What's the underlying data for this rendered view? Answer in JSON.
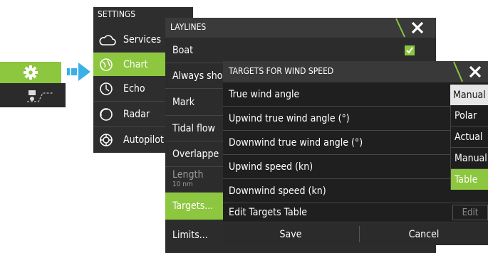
{
  "launcher": {
    "settings_icon": "gear-icon",
    "chart_icon": "chart-icon",
    "arrow_icon": "arrow-right-icon"
  },
  "settings": {
    "title": "SETTINGS",
    "items": [
      {
        "label": "Services",
        "icon": "cloud-icon"
      },
      {
        "label": "Chart",
        "icon": "globe-icon",
        "selected": true
      },
      {
        "label": "Echo",
        "icon": "echo-icon"
      },
      {
        "label": "Radar",
        "icon": "radar-icon"
      },
      {
        "label": "Autopilot",
        "icon": "autopilot-icon"
      }
    ]
  },
  "laylines": {
    "title": "LAYLINES",
    "items": [
      {
        "label": "Boat",
        "checked": true
      },
      {
        "label": "Always sho"
      },
      {
        "label": "Mark"
      },
      {
        "label": "Tidal flow"
      },
      {
        "label": "Overlappe"
      },
      {
        "label": "Length",
        "sub": "10 nm"
      },
      {
        "label": "Targets...",
        "selected": true
      },
      {
        "label": "Limits..."
      }
    ]
  },
  "targets": {
    "title": "TARGETS FOR WIND SPEED",
    "rows": [
      {
        "label": "True wind angle",
        "value": "Manual"
      },
      {
        "label": "Upwind true wind angle (°)"
      },
      {
        "label": "Downwind true wind angle (°)"
      },
      {
        "label": "Upwind speed (kn)"
      },
      {
        "label": "Downwind speed (kn)"
      },
      {
        "label": "Edit Targets Table",
        "value": "Edit"
      }
    ],
    "save_label": "Save",
    "cancel_label": "Cancel"
  },
  "dropdown": {
    "selected": "Manual",
    "options": [
      "Polar",
      "Actual",
      "Manual",
      "Table"
    ],
    "highlighted": "Table"
  },
  "colors": {
    "accent": "#8dc63f",
    "panel": "#2c2c2c",
    "header": "#3a3a3a"
  }
}
